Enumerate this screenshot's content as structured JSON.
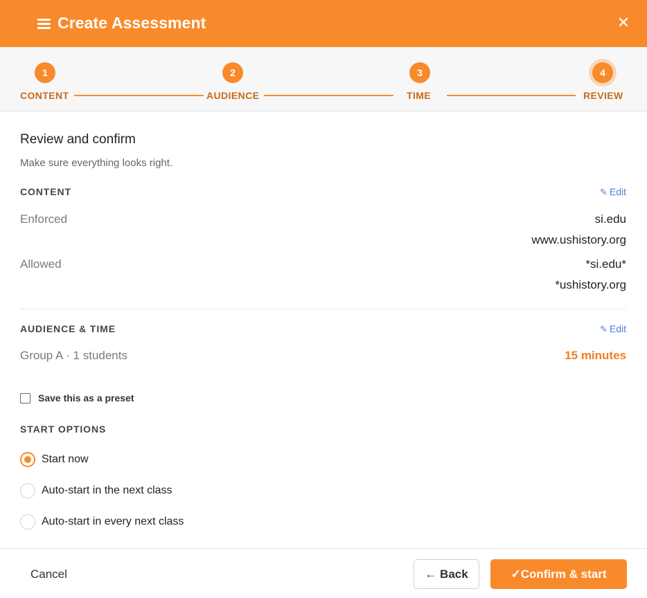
{
  "header": {
    "title": "Create Assessment",
    "menu_icon": "hamburger-menu-icon",
    "close_icon": "close-icon",
    "close_glyph": "✕"
  },
  "stepper": {
    "steps": [
      {
        "number": "1",
        "label": "CONTENT"
      },
      {
        "number": "2",
        "label": "AUDIENCE"
      },
      {
        "number": "3",
        "label": "TIME"
      },
      {
        "number": "4",
        "label": "REVIEW"
      }
    ],
    "current_step": 4
  },
  "review": {
    "title": "Review and confirm",
    "subtitle": "Make sure everything looks right."
  },
  "content_section": {
    "label": "CONTENT",
    "edit_label": "Edit",
    "edit_icon": "pencil-icon",
    "enforced_label": "Enforced",
    "enforced_values": [
      "si.edu",
      "www.ushistory.org"
    ],
    "allowed_label": "Allowed",
    "allowed_values": [
      "*si.edu*",
      "*ushistory.org"
    ]
  },
  "audience_section": {
    "label": "AUDIENCE & TIME",
    "edit_label": "Edit",
    "edit_icon": "pencil-icon",
    "group_text": "Group A · 1 students",
    "duration_text": "15 minutes"
  },
  "preset": {
    "label": "Save this as a preset",
    "checked": false
  },
  "start_options": {
    "label": "START OPTIONS",
    "options": [
      {
        "label": "Start now",
        "selected": true
      },
      {
        "label": "Auto-start in the next class",
        "selected": false
      },
      {
        "label": "Auto-start in every next class",
        "selected": false
      }
    ]
  },
  "footer": {
    "cancel_label": "Cancel",
    "back_label": "← Back",
    "confirm_label": "✓Confirm & start"
  },
  "colors": {
    "accent": "#f98a2b",
    "link": "#4a7ee0",
    "step_label": "#c96a1c"
  }
}
